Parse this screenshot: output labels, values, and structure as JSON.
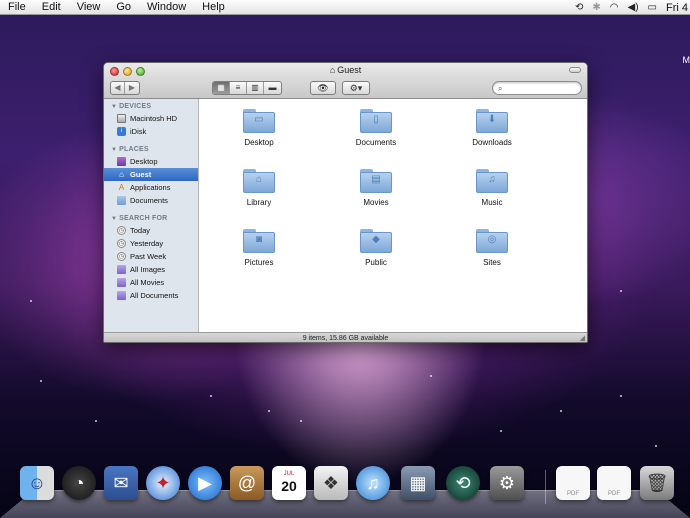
{
  "menubar": {
    "items": [
      "File",
      "Edit",
      "View",
      "Go",
      "Window",
      "Help"
    ],
    "clock": "Fri 4"
  },
  "desktop": {
    "hd_label": "M"
  },
  "window": {
    "title": "Guest",
    "search_placeholder": "",
    "status": "9 items, 15.86 GB available"
  },
  "sidebar": {
    "devices_header": "DEVICES",
    "devices": [
      "Macintosh HD",
      "iDisk"
    ],
    "places_header": "PLACES",
    "places": [
      "Desktop",
      "Guest",
      "Applications",
      "Documents"
    ],
    "search_header": "SEARCH FOR",
    "search_for": [
      "Today",
      "Yesterday",
      "Past Week",
      "All Images",
      "All Movies",
      "All Documents"
    ]
  },
  "files": [
    "Desktop",
    "Documents",
    "Downloads",
    "Library",
    "Movies",
    "Music",
    "Pictures",
    "Public",
    "Sites"
  ],
  "dock": {
    "calendar_day": "20",
    "calendar_month": "JUL",
    "pdf_label": "PDF"
  }
}
